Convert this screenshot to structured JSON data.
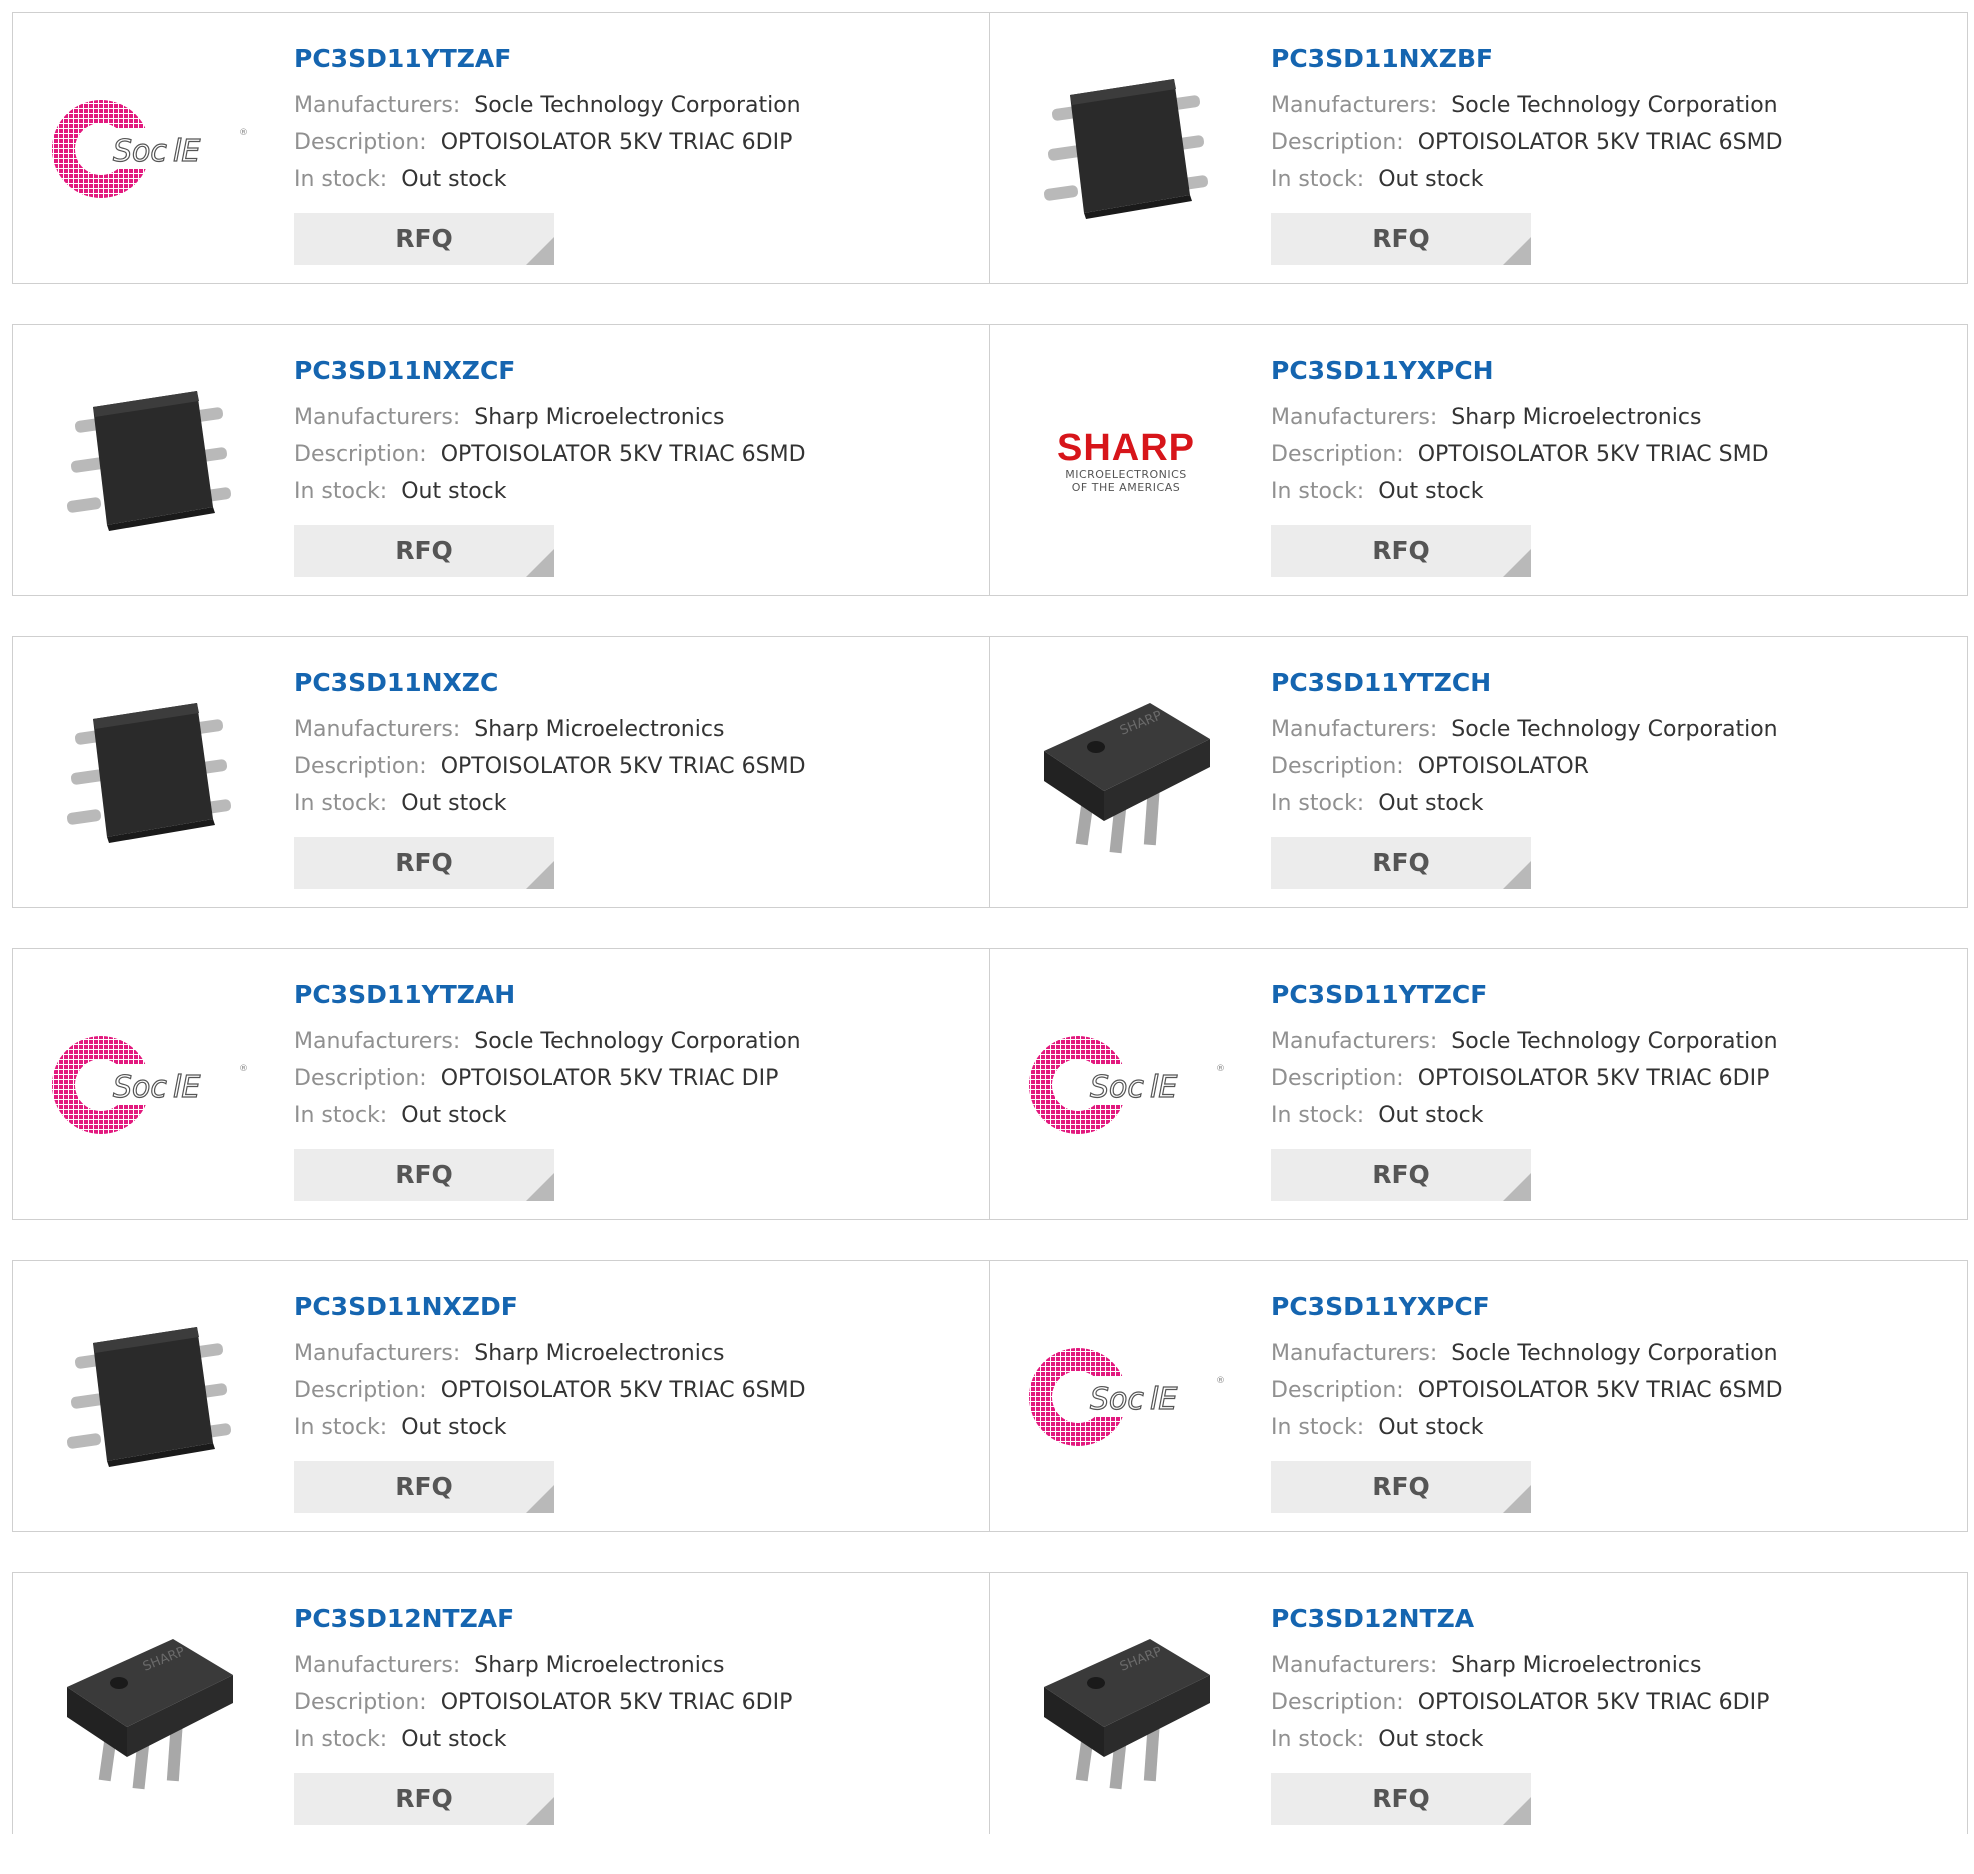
{
  "labels": {
    "manufacturers": "Manufacturers:",
    "description": "Description:",
    "in_stock": "In stock:",
    "rfq": "RFQ"
  },
  "products": [
    {
      "part": "PC3SD11YTZAF",
      "manufacturer": "Socle Technology Corporation",
      "description": "OPTOISOLATOR 5KV TRIAC 6DIP",
      "stock": "Out stock",
      "image": "socle-logo"
    },
    {
      "part": "PC3SD11NXZBF",
      "manufacturer": "Socle Technology Corporation",
      "description": "OPTOISOLATOR 5KV TRIAC 6SMD",
      "stock": "Out stock",
      "image": "smd-chip"
    },
    {
      "part": "PC3SD11NXZCF",
      "manufacturer": "Sharp Microelectronics",
      "description": "OPTOISOLATOR 5KV TRIAC 6SMD",
      "stock": "Out stock",
      "image": "smd-chip"
    },
    {
      "part": "PC3SD11YXPCH",
      "manufacturer": "Sharp Microelectronics",
      "description": "OPTOISOLATOR 5KV TRIAC SMD",
      "stock": "Out stock",
      "image": "sharp-logo",
      "logo_text": "SHARP",
      "logo_sub1": "MICROELECTRONICS",
      "logo_sub2": "OF THE AMERICAS"
    },
    {
      "part": "PC3SD11NXZC",
      "manufacturer": "Sharp Microelectronics",
      "description": "OPTOISOLATOR 5KV TRIAC 6SMD",
      "stock": "Out stock",
      "image": "smd-chip"
    },
    {
      "part": "PC3SD11YTZCH",
      "manufacturer": "Socle Technology Corporation",
      "description": "OPTOISOLATOR",
      "stock": "Out stock",
      "image": "dip-chip"
    },
    {
      "part": "PC3SD11YTZAH",
      "manufacturer": "Socle Technology Corporation",
      "description": "OPTOISOLATOR 5KV TRIAC DIP",
      "stock": "Out stock",
      "image": "socle-logo"
    },
    {
      "part": "PC3SD11YTZCF",
      "manufacturer": "Socle Technology Corporation",
      "description": "OPTOISOLATOR 5KV TRIAC 6DIP",
      "stock": "Out stock",
      "image": "socle-logo"
    },
    {
      "part": "PC3SD11NXZDF",
      "manufacturer": "Sharp Microelectronics",
      "description": "OPTOISOLATOR 5KV TRIAC 6SMD",
      "stock": "Out stock",
      "image": "smd-chip"
    },
    {
      "part": "PC3SD11YXPCF",
      "manufacturer": "Socle Technology Corporation",
      "description": "OPTOISOLATOR 5KV TRIAC 6SMD",
      "stock": "Out stock",
      "image": "socle-logo"
    },
    {
      "part": "PC3SD12NTZAF",
      "manufacturer": "Sharp Microelectronics",
      "description": "OPTOISOLATOR 5KV TRIAC 6DIP",
      "stock": "Out stock",
      "image": "dip-chip"
    },
    {
      "part": "PC3SD12NTZA",
      "manufacturer": "Sharp Microelectronics",
      "description": "OPTOISOLATOR 5KV TRIAC 6DIP",
      "stock": "Out stock",
      "image": "dip-chip"
    }
  ],
  "colors": {
    "part_link": "#1565b0",
    "label": "#909090",
    "value": "#333333",
    "rfq_bg": "#ececec",
    "socle_pink": "#e2197e",
    "sharp_red": "#d7151a"
  }
}
